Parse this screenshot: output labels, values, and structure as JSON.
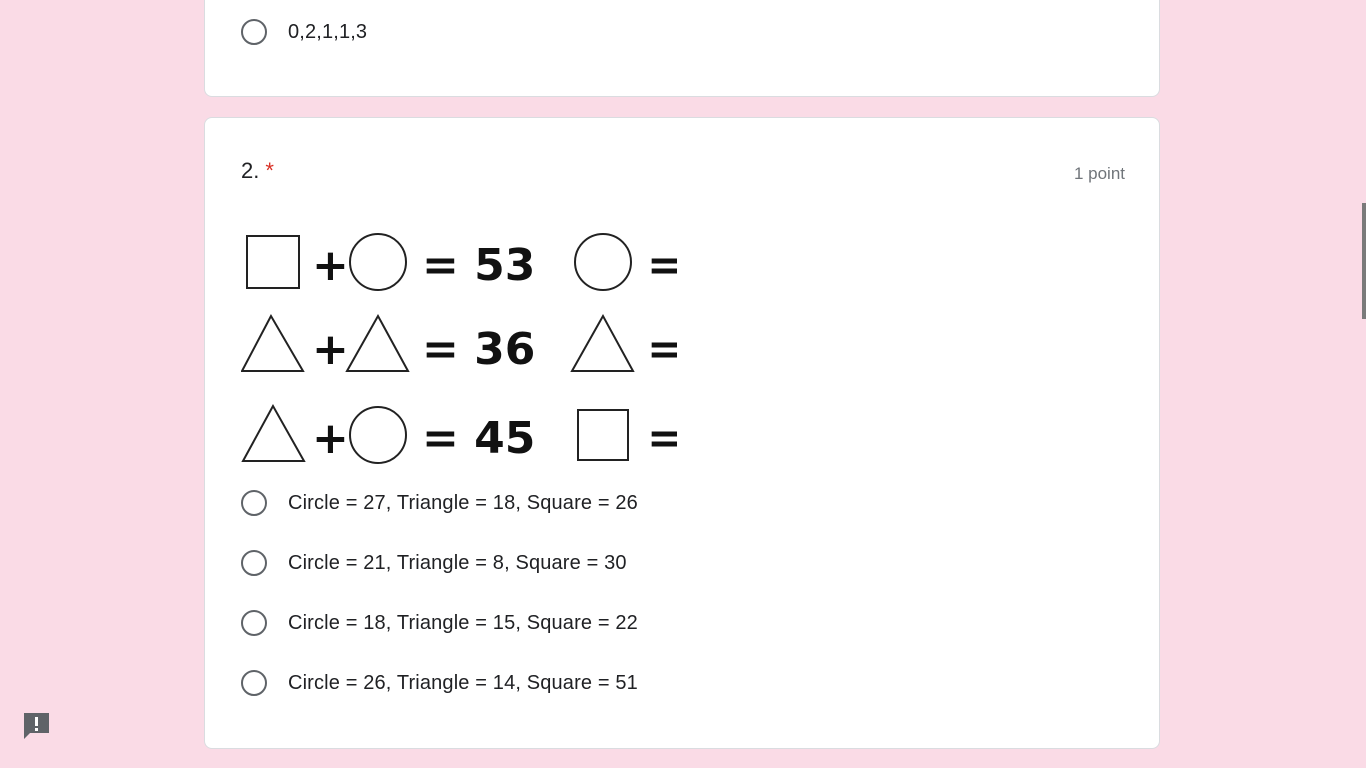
{
  "question1": {
    "last_option": "0,2,1,1,3"
  },
  "question2": {
    "number": "2.",
    "required_mark": "*",
    "points": "1 point",
    "equations": [
      {
        "lhs": [
          "square",
          "circle"
        ],
        "result": "= 53",
        "ask": "circle"
      },
      {
        "lhs": [
          "triangle",
          "triangle"
        ],
        "result": "= 36",
        "ask": "triangle"
      },
      {
        "lhs": [
          "triangle",
          "circle"
        ],
        "result": "= 45",
        "ask": "square"
      }
    ],
    "plus": "+",
    "equals": "=",
    "options": [
      "Circle = 27, Triangle = 18, Square = 26",
      "Circle = 21, Triangle = 8, Square = 30",
      "Circle = 18, Triangle = 15, Square = 22",
      "Circle = 26, Triangle = 14, Square = 51"
    ]
  },
  "icons": {
    "report": "exclamation-feedback-icon"
  },
  "colors": {
    "background": "#fadbe6",
    "card": "#ffffff",
    "required": "#d93025",
    "radio_border": "#5f6368"
  }
}
